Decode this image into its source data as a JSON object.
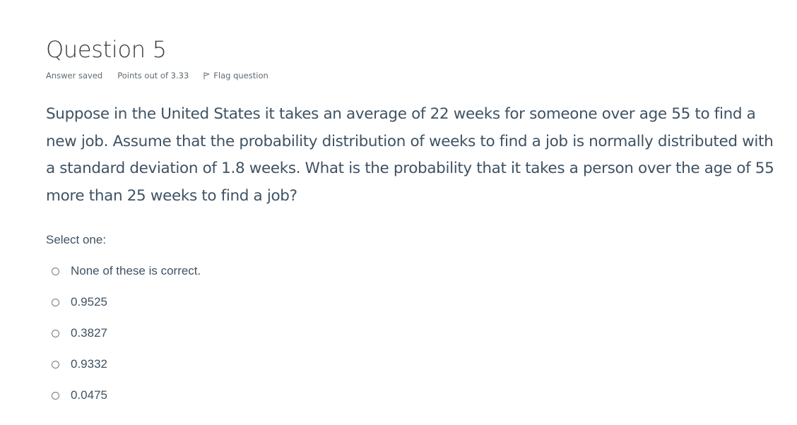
{
  "question": {
    "title": "Question 5",
    "state": "Answer saved",
    "grade": "Points out of 3.33",
    "flag_label": "Flag question",
    "text": "Suppose in the United States it takes an average of 22 weeks for someone over age 55 to find a new job.  Assume that the probability distribution of weeks to find a job is normally distributed with a standard deviation of 1.8 weeks.  What is the probability that it takes a person over the age of 55 more than 25 weeks to find a job?"
  },
  "answer": {
    "prompt": "Select one:",
    "options": [
      {
        "label": "None of these is correct.",
        "selected": false
      },
      {
        "label": "0.9525",
        "selected": false
      },
      {
        "label": "0.3827",
        "selected": false
      },
      {
        "label": "0.9332",
        "selected": false
      },
      {
        "label": "0.0475",
        "selected": false
      }
    ]
  },
  "icons": {
    "flag": "flag-icon",
    "radio": "radio-button"
  },
  "colors": {
    "title": "#373a3c",
    "body_text": "#3f5263",
    "meta_text": "#5f6a72"
  }
}
